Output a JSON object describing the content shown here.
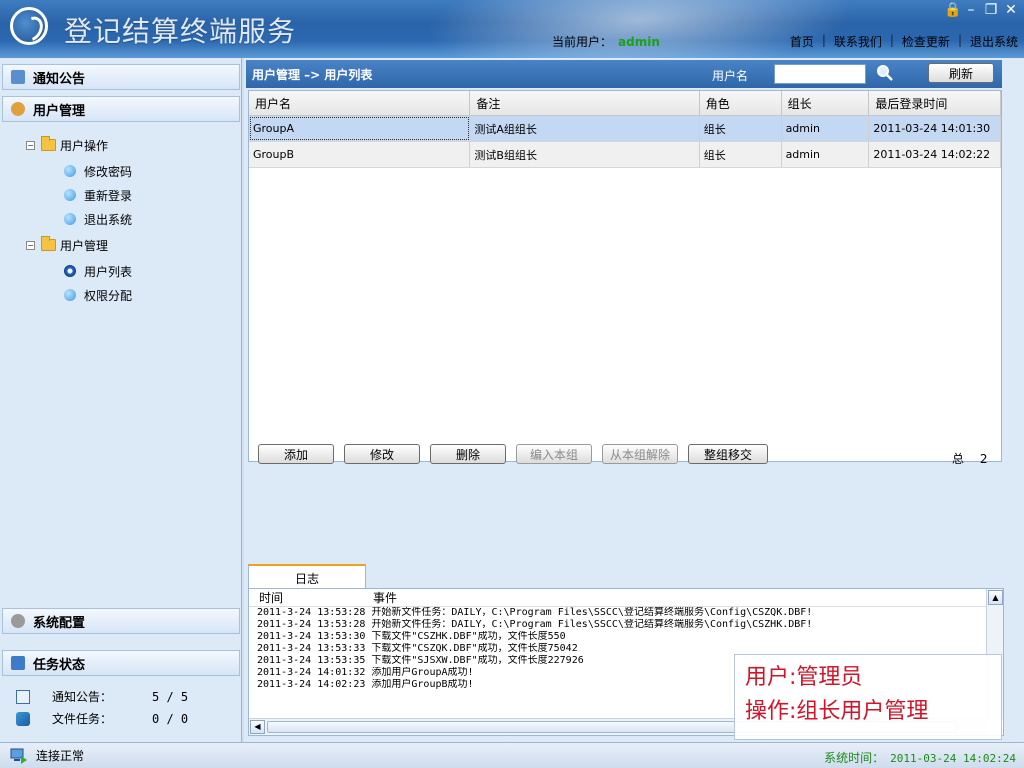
{
  "window": {
    "title": "登记结算终端服务",
    "current_user_label": "当前用户：",
    "current_user": "admin",
    "nav": [
      "首页",
      "联系我们",
      "检查更新",
      "退出系统"
    ]
  },
  "sidebar": {
    "notice_panel": "通知公告",
    "user_panel": "用户管理",
    "tree": [
      {
        "label": "用户操作",
        "children": [
          "修改密码",
          "重新登录",
          "退出系统"
        ]
      },
      {
        "label": "用户管理",
        "children": [
          "用户列表",
          "权限分配"
        ]
      }
    ],
    "config_panel": "系统配置",
    "task_panel": "任务状态",
    "stats": [
      {
        "label": "通知公告：",
        "value": "5 / 5"
      },
      {
        "label": "文件任务：",
        "value": "0 / 0"
      }
    ]
  },
  "main": {
    "breadcrumb": "用户管理 –> 用户列表",
    "search_label": "用户名",
    "search_value": "",
    "refresh_label": "刷新",
    "columns": [
      "用户名",
      "备注",
      "角色",
      "组长",
      "最后登录时间"
    ],
    "rows": [
      [
        "GroupA",
        "测试A组组长",
        "组长",
        "admin",
        "2011-03-24 14:01:30"
      ],
      [
        "GroupB",
        "测试B组组长",
        "组长",
        "admin",
        "2011-03-24 14:02:22"
      ]
    ],
    "actions": [
      "添加",
      "修改",
      "删除",
      "编入本组",
      "从本组解除",
      "整组移交"
    ],
    "total_label": "总",
    "total_value": "2"
  },
  "log": {
    "tab": "日志",
    "col_time": "时间",
    "col_event": "事件",
    "lines": [
      "2011-3-24 13:53:28  开始新文件任务：DAILY，C:\\Program Files\\SSCC\\登记结算终端服务\\Config\\CSZQK.DBF!",
      "2011-3-24 13:53:28  开始新文件任务：DAILY，C:\\Program Files\\SSCC\\登记结算终端服务\\Config\\CSZHK.DBF!",
      "2011-3-24 13:53:30  下载文件\"CSZHK.DBF\"成功，文件长度550",
      "2011-3-24 13:53:33  下载文件\"CSZQK.DBF\"成功，文件长度75042",
      "2011-3-24 13:53:35  下载文件\"SJSXW.DBF\"成功，文件长度227926",
      "2011-3-24 14:01:32  添加用户GroupA成功!",
      "2011-3-24 14:02:23  添加用户GroupB成功!"
    ]
  },
  "overlay": {
    "line1": "用户:管理员",
    "line2": "操作:组长用户管理"
  },
  "status": {
    "connection": "连接正常",
    "sys_time_label": "系统时间：",
    "sys_time": "2011-03-24 14:02:24"
  },
  "colors": {
    "titlebar": "#2a63a8",
    "panel": "#dce9f7",
    "user_green": "#1aa11a",
    "overlay_red": "#d2142a"
  }
}
